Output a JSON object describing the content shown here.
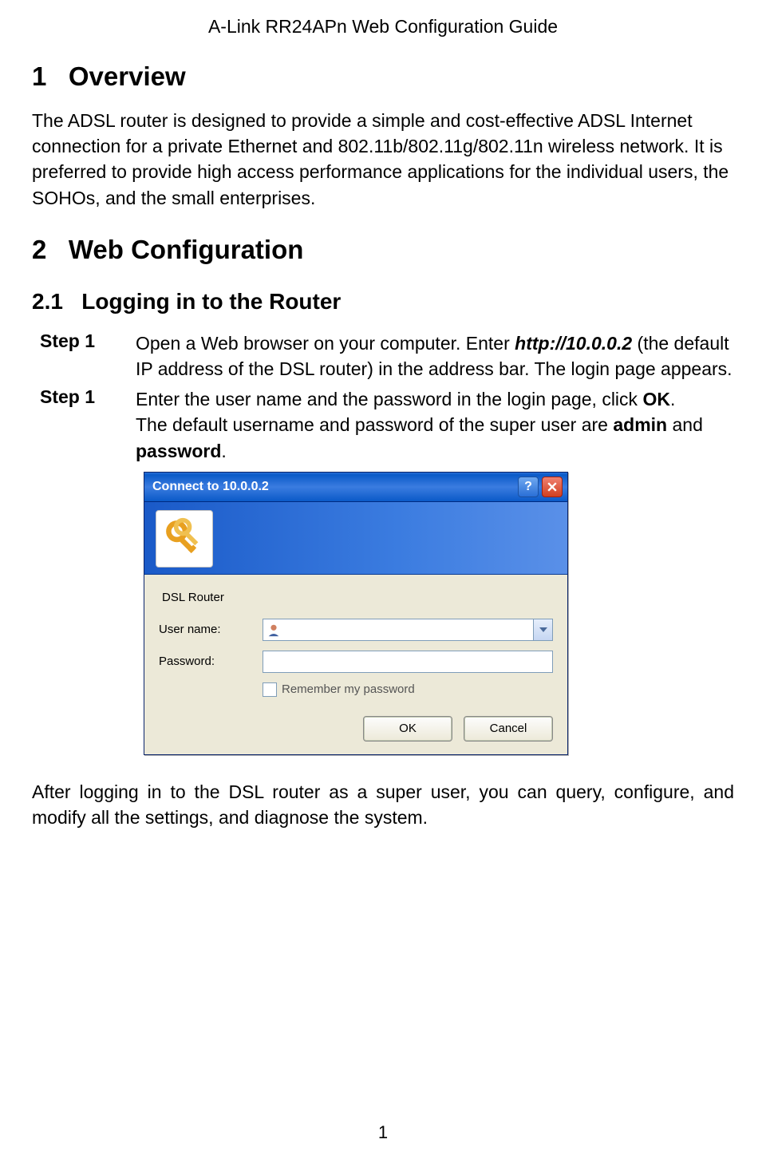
{
  "header": "A-Link RR24APn Web Configuration Guide",
  "section1": {
    "num": "1",
    "title": "Overview"
  },
  "para1": "The ADSL router is designed to provide a simple and cost-effective ADSL Internet connection for a private Ethernet and 802.11b/802.11g/802.11n wireless network. It is preferred to provide high access performance applications for the individual users, the SOHOs, and the small enterprises.",
  "section2": {
    "num": "2",
    "title": "Web Configuration"
  },
  "subsection21": {
    "num": "2.1",
    "title": "Logging in to the Router"
  },
  "steps": [
    {
      "label": "Step 1",
      "pre": "Open a Web browser on your computer. Enter ",
      "bold_italic": "http://10.0.0.2",
      "post": " (the default IP address of the DSL router) in the address bar. The login page appears."
    },
    {
      "label": "Step 1",
      "line1_pre": "Enter the user name and the password in the login page, click ",
      "line1_bold": "OK",
      "line1_post": ".",
      "line2_pre": "The default username and password of the super user are ",
      "line2_b1": "admin",
      "line2_mid": " and ",
      "line2_b2": "password",
      "line2_post": "."
    }
  ],
  "dialog": {
    "title": "Connect to 10.0.0.2",
    "realm": "DSL Router",
    "user_label": "User name:",
    "pass_label": "Password:",
    "remember": "Remember my password",
    "ok": "OK",
    "cancel": "Cancel"
  },
  "after": "After logging in to the DSL router as a super user, you can query, configure, and modify all the settings, and diagnose the system.",
  "page_num": "1"
}
